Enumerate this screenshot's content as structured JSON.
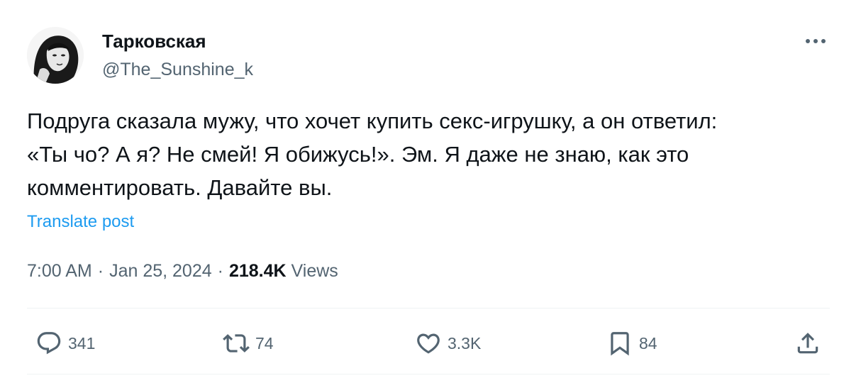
{
  "author": {
    "display_name": "Тарковская",
    "handle": "@The_Sunshine_k"
  },
  "tweet": {
    "text": "Подруга сказала мужу, что хочет купить секс-игрушку, а он ответил:\n«Ты чо? А я? Не смей! Я обижусь!». Эм. Я даже не знаю, как это\nкомментировать. Давайте вы.",
    "translate_label": "Translate post"
  },
  "meta": {
    "time": "7:00 AM",
    "separator": "·",
    "date": "Jan 25, 2024",
    "views_count": "218.4K",
    "views_label": "Views"
  },
  "actions": {
    "reply": {
      "icon": "reply-icon",
      "count": "341"
    },
    "retweet": {
      "icon": "retweet-icon",
      "count": "74"
    },
    "like": {
      "icon": "heart-icon",
      "count": "3.3K"
    },
    "bookmark": {
      "icon": "bookmark-icon",
      "count": "84"
    },
    "share": {
      "icon": "share-icon"
    }
  },
  "colors": {
    "text_primary": "#0f1419",
    "text_secondary": "#536471",
    "link": "#1d9bf0",
    "divider": "#eff3f4"
  }
}
